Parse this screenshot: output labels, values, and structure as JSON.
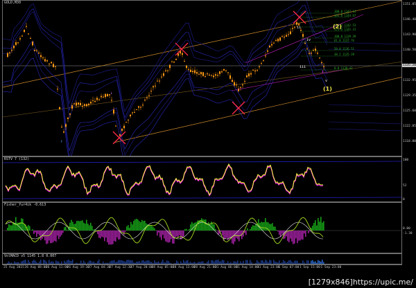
{
  "main": {
    "title": "GOLD,M30",
    "price_ticks": [
      "1151.05",
      "1146.40",
      "1143.90",
      "1140.50",
      "1136.90",
      "1132.95",
      "1129.35",
      "1125.60",
      "1122.05",
      "1118.00"
    ],
    "current_price": "1135.20",
    "fib_levels": [
      "100.0 1147.14",
      "161.8 1144.67",
      "138.2 1142.53",
      "123.6 1141.31",
      "100.0 1139.28",
      "61.8 1137.76",
      "50.0 1136.51",
      "38.2 1135.28",
      "0.0 1130.42"
    ],
    "wave_labels": {
      "w2": "(2)",
      "w1": "(1)",
      "ii": "ii",
      "iv": "iv",
      "iii": "iii",
      "v": "v"
    },
    "colors": {
      "candle": "#ff9a14",
      "bands": "#1d1d9b",
      "channel": "#d08c2c",
      "cross": "#ff2a4a",
      "fib": "#2fae2f",
      "waves": "#f0e24a"
    }
  },
  "rsi": {
    "title": "RSTV 7 (132)",
    "ticks": [
      "100",
      "52",
      "0"
    ],
    "colors": {
      "line": "#ffff3c",
      "signal": "#ff2aff",
      "bands": "#2020c0"
    }
  },
  "fisher": {
    "title": "Fisher_Yur4ik -0.613",
    "ticks": [
      "0.00",
      "-1.30"
    ],
    "colors": {
      "pos": "#16a016",
      "neg": "#a020a0",
      "line": "#a8e020"
    }
  },
  "vol": {
    "title": "VolMACD v5  1145 1.8 0.007"
  },
  "time_axis": [
    "25 Aug 2015",
    "26 Aug 08:00",
    "26 Aug 11:00",
    "26 Aug 19:30",
    "27 Aug 04:30",
    "27 Aug 12:30",
    "27 Aug 20:00",
    "28 Aug 05:00",
    "28 Aug 13:00",
    "28 Aug 21:00",
    "31 Aug 06:00",
    "31 Aug 14:00",
    "31 Aug 23:00",
    "1 Sep 07:00",
    "1 Sep 15:00",
    "1 Sep 23:00"
  ],
  "watermark": "[1279x846]https://upic.me/"
}
